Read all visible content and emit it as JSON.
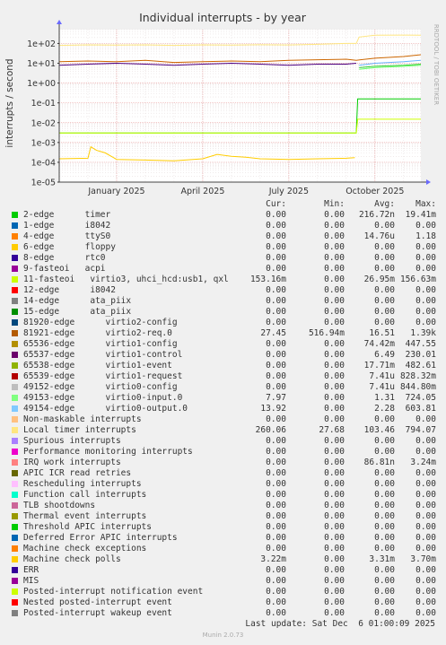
{
  "chart_data": {
    "type": "line",
    "title": "Individual interrupts - by year",
    "ylabel": "interrupts / second",
    "watermark": "RRDTOOL / TOBI OETIKER",
    "scale": "log",
    "ylim": [
      1e-05,
      500
    ],
    "y_ticks": [
      {
        "value": 100,
        "label": "1e+02"
      },
      {
        "value": 10,
        "label": "1e+01"
      },
      {
        "value": 1,
        "label": "1e+00"
      },
      {
        "value": 0.1,
        "label": "1e-01"
      },
      {
        "value": 0.01,
        "label": "1e-02"
      },
      {
        "value": 0.001,
        "label": "1e-03"
      },
      {
        "value": 0.0001,
        "label": "1e-04"
      },
      {
        "value": 1e-05,
        "label": "1e-05"
      }
    ],
    "x_range": [
      0,
      12.6
    ],
    "x_ticks": [
      {
        "pos": 2.0,
        "label": "January 2025"
      },
      {
        "pos": 5.0,
        "label": "April 2025"
      },
      {
        "pos": 8.0,
        "label": "July 2025"
      },
      {
        "pos": 11.0,
        "label": "October 2025"
      }
    ],
    "grid": true,
    "series": [
      {
        "name": "Local timer interrupts",
        "color": "#FFE680",
        "x": [
          0,
          1,
          2,
          3,
          4,
          5,
          6,
          7,
          8,
          9,
          10,
          10.35,
          10.45,
          11,
          12,
          12.6
        ],
        "y": [
          80,
          85,
          82,
          85,
          80,
          85,
          82,
          86,
          84,
          90,
          100,
          100,
          210,
          260,
          265,
          260
        ]
      },
      {
        "name": "timer",
        "color": "#00CC00",
        "x": [
          0,
          10.3,
          10.35,
          10.4,
          12.6
        ],
        "y": [
          0.003,
          0.003,
          0.003,
          0.16,
          0.16
        ]
      },
      {
        "name": "11-fasteoi",
        "color": "#CCFF00",
        "x": [
          0,
          10.3,
          10.35,
          10.4,
          12.6
        ],
        "y": [
          0.003,
          0.003,
          0.003,
          0.015,
          0.015
        ]
      },
      {
        "name": "81921-edge",
        "color": "#CC6600",
        "x": [
          0,
          1,
          2,
          3,
          4,
          5,
          6,
          7,
          8,
          9,
          10,
          10.35,
          10.5,
          11,
          12,
          12.6
        ],
        "y": [
          12,
          13,
          12,
          14,
          11,
          12,
          13,
          12,
          14,
          15,
          16,
          14,
          15,
          18,
          22,
          27
        ]
      },
      {
        "name": "65537-edge",
        "color": "#4D0080",
        "x": [
          0,
          1,
          2,
          3,
          4,
          5,
          6,
          7,
          8,
          9,
          10,
          10.35
        ],
        "y": [
          8,
          9,
          10,
          9,
          8,
          9,
          10,
          9,
          8,
          9,
          9,
          10
        ]
      },
      {
        "name": "65539-edge",
        "color": "#33CC33",
        "x": [
          10.45,
          11,
          12,
          12.6
        ],
        "y": [
          6,
          7,
          8,
          9
        ]
      },
      {
        "name": "49154-edge",
        "color": "#66B3FF",
        "x": [
          10.45,
          11,
          12,
          12.6
        ],
        "y": [
          8,
          10,
          12,
          14
        ]
      },
      {
        "name": "49153-edge",
        "color": "#66FF66",
        "x": [
          10.45,
          11,
          12,
          12.6
        ],
        "y": [
          5,
          6,
          7,
          8
        ]
      },
      {
        "name": "Machine check polls",
        "color": "#FFCC00",
        "x": [
          0,
          1.0,
          1.1,
          1.3,
          1.6,
          2,
          3,
          4,
          5,
          5.5,
          6,
          6.5,
          7,
          8,
          9,
          10,
          10.3
        ],
        "y": [
          0.00015,
          0.00016,
          0.0006,
          0.0004,
          0.0003,
          0.00014,
          0.00013,
          0.00012,
          0.00015,
          0.00025,
          0.0002,
          0.00018,
          0.00015,
          0.00014,
          0.00015,
          0.00016,
          0.00017
        ]
      }
    ]
  },
  "legend": {
    "headers": {
      "cur": "Cur:",
      "min": "Min:",
      "avg": "Avg:",
      "max": "Max:"
    },
    "rows": [
      {
        "color": "#00CC00",
        "label": "2-edge      timer",
        "cur": "0.00",
        "min": "0.00",
        "avg": "216.72n",
        "max": "19.41m"
      },
      {
        "color": "#0066B3",
        "label": "1-edge      i8042",
        "cur": "0.00",
        "min": "0.00",
        "avg": "0.00",
        "max": "0.00"
      },
      {
        "color": "#FF8000",
        "label": "4-edge      ttyS0",
        "cur": "0.00",
        "min": "0.00",
        "avg": "14.76u",
        "max": "1.18"
      },
      {
        "color": "#FFCC00",
        "label": "6-edge      floppy",
        "cur": "0.00",
        "min": "0.00",
        "avg": "0.00",
        "max": "0.00"
      },
      {
        "color": "#330099",
        "label": "8-edge      rtc0",
        "cur": "0.00",
        "min": "0.00",
        "avg": "0.00",
        "max": "0.00"
      },
      {
        "color": "#990099",
        "label": "9-fasteoi   acpi",
        "cur": "0.00",
        "min": "0.00",
        "avg": "0.00",
        "max": "0.00"
      },
      {
        "color": "#CCFF00",
        "label": "11-fasteoi   virtio3, uhci_hcd:usb1, qxl",
        "cur": "153.16m",
        "min": "0.00",
        "avg": "26.95m",
        "max": "156.63m"
      },
      {
        "color": "#FF0000",
        "label": "12-edge      i8042",
        "cur": "0.00",
        "min": "0.00",
        "avg": "0.00",
        "max": "0.00"
      },
      {
        "color": "#808080",
        "label": "14-edge      ata_piix",
        "cur": "0.00",
        "min": "0.00",
        "avg": "0.00",
        "max": "0.00"
      },
      {
        "color": "#008F00",
        "label": "15-edge      ata_piix",
        "cur": "0.00",
        "min": "0.00",
        "avg": "0.00",
        "max": "0.00"
      },
      {
        "color": "#00487D",
        "label": "81920-edge      virtio2-config",
        "cur": "0.00",
        "min": "0.00",
        "avg": "0.00",
        "max": "0.00"
      },
      {
        "color": "#B35A00",
        "label": "81921-edge      virtio2-req.0",
        "cur": "27.45",
        "min": "516.94m",
        "avg": "16.51",
        "max": "1.39k"
      },
      {
        "color": "#B38F00",
        "label": "65536-edge      virtio1-config",
        "cur": "0.00",
        "min": "0.00",
        "avg": "74.42m",
        "max": "447.55"
      },
      {
        "color": "#6B006B",
        "label": "65537-edge      virtio1-control",
        "cur": "0.00",
        "min": "0.00",
        "avg": "6.49",
        "max": "230.01"
      },
      {
        "color": "#8FB300",
        "label": "65538-edge      virtio1-event",
        "cur": "0.00",
        "min": "0.00",
        "avg": "17.71m",
        "max": "482.61"
      },
      {
        "color": "#B30000",
        "label": "65539-edge      virtio1-request",
        "cur": "0.00",
        "min": "0.00",
        "avg": "7.41u",
        "max": "828.32m"
      },
      {
        "color": "#BEBEBE",
        "label": "49152-edge      virtio0-config",
        "cur": "0.00",
        "min": "0.00",
        "avg": "7.41u",
        "max": "844.80m"
      },
      {
        "color": "#80FF80",
        "label": "49153-edge      virtio0-input.0",
        "cur": "7.97",
        "min": "0.00",
        "avg": "1.31",
        "max": "724.05"
      },
      {
        "color": "#80C9FF",
        "label": "49154-edge      virtio0-output.0",
        "cur": "13.92",
        "min": "0.00",
        "avg": "2.28",
        "max": "603.81"
      },
      {
        "color": "#FFC080",
        "label": "Non-maskable interrupts",
        "cur": "0.00",
        "min": "0.00",
        "avg": "0.00",
        "max": "0.00"
      },
      {
        "color": "#FFE680",
        "label": "Local timer interrupts",
        "cur": "260.06",
        "min": "27.68",
        "avg": "103.46",
        "max": "794.07"
      },
      {
        "color": "#AA80FF",
        "label": "Spurious interrupts",
        "cur": "0.00",
        "min": "0.00",
        "avg": "0.00",
        "max": "0.00"
      },
      {
        "color": "#EE00CC",
        "label": "Performance monitoring interrupts",
        "cur": "0.00",
        "min": "0.00",
        "avg": "0.00",
        "max": "0.00"
      },
      {
        "color": "#FF8080",
        "label": "IRQ work interrupts",
        "cur": "0.00",
        "min": "0.00",
        "avg": "86.81n",
        "max": "3.24m"
      },
      {
        "color": "#666600",
        "label": "APIC ICR read retries",
        "cur": "0.00",
        "min": "0.00",
        "avg": "0.00",
        "max": "0.00"
      },
      {
        "color": "#FFBFFF",
        "label": "Rescheduling interrupts",
        "cur": "0.00",
        "min": "0.00",
        "avg": "0.00",
        "max": "0.00"
      },
      {
        "color": "#00FFCC",
        "label": "Function call interrupts",
        "cur": "0.00",
        "min": "0.00",
        "avg": "0.00",
        "max": "0.00"
      },
      {
        "color": "#CC6699",
        "label": "TLB shootdowns",
        "cur": "0.00",
        "min": "0.00",
        "avg": "0.00",
        "max": "0.00"
      },
      {
        "color": "#999900",
        "label": "Thermal event interrupts",
        "cur": "0.00",
        "min": "0.00",
        "avg": "0.00",
        "max": "0.00"
      },
      {
        "color": "#00CC00",
        "label": "Threshold APIC interrupts",
        "cur": "0.00",
        "min": "0.00",
        "avg": "0.00",
        "max": "0.00"
      },
      {
        "color": "#0066B3",
        "label": "Deferred Error APIC interrupts",
        "cur": "0.00",
        "min": "0.00",
        "avg": "0.00",
        "max": "0.00"
      },
      {
        "color": "#FF8000",
        "label": "Machine check exceptions",
        "cur": "0.00",
        "min": "0.00",
        "avg": "0.00",
        "max": "0.00"
      },
      {
        "color": "#FFCC00",
        "label": "Machine check polls",
        "cur": "3.22m",
        "min": "0.00",
        "avg": "3.31m",
        "max": "3.70m"
      },
      {
        "color": "#330099",
        "label": "ERR",
        "cur": "0.00",
        "min": "0.00",
        "avg": "0.00",
        "max": "0.00"
      },
      {
        "color": "#990099",
        "label": "MIS",
        "cur": "0.00",
        "min": "0.00",
        "avg": "0.00",
        "max": "0.00"
      },
      {
        "color": "#CCFF00",
        "label": "Posted-interrupt notification event",
        "cur": "0.00",
        "min": "0.00",
        "avg": "0.00",
        "max": "0.00"
      },
      {
        "color": "#FF0000",
        "label": "Nested posted-interrupt event",
        "cur": "0.00",
        "min": "0.00",
        "avg": "0.00",
        "max": "0.00"
      },
      {
        "color": "#808080",
        "label": "Posted-interrupt wakeup event",
        "cur": "0.00",
        "min": "0.00",
        "avg": "0.00",
        "max": "0.00"
      }
    ]
  },
  "last_update": "Last update: Sat Dec  6 01:00:09 2025",
  "footer": "Munin 2.0.73"
}
